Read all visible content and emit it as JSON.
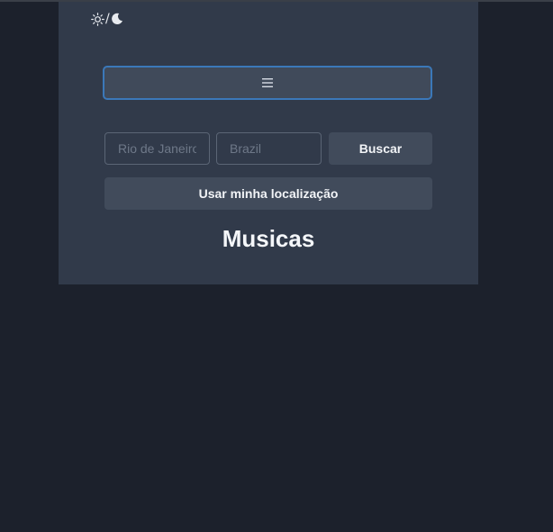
{
  "theme_toggle": {
    "sun_icon": "sun-icon",
    "separator": "/",
    "moon_icon": "moon-icon"
  },
  "menu": {
    "icon": "hamburger-menu-icon"
  },
  "search": {
    "city_placeholder": "Rio de Janeiro",
    "country_placeholder": "Brazil",
    "button_label": "Buscar"
  },
  "location": {
    "button_label": "Usar minha localização"
  },
  "section": {
    "title": "Musicas"
  }
}
